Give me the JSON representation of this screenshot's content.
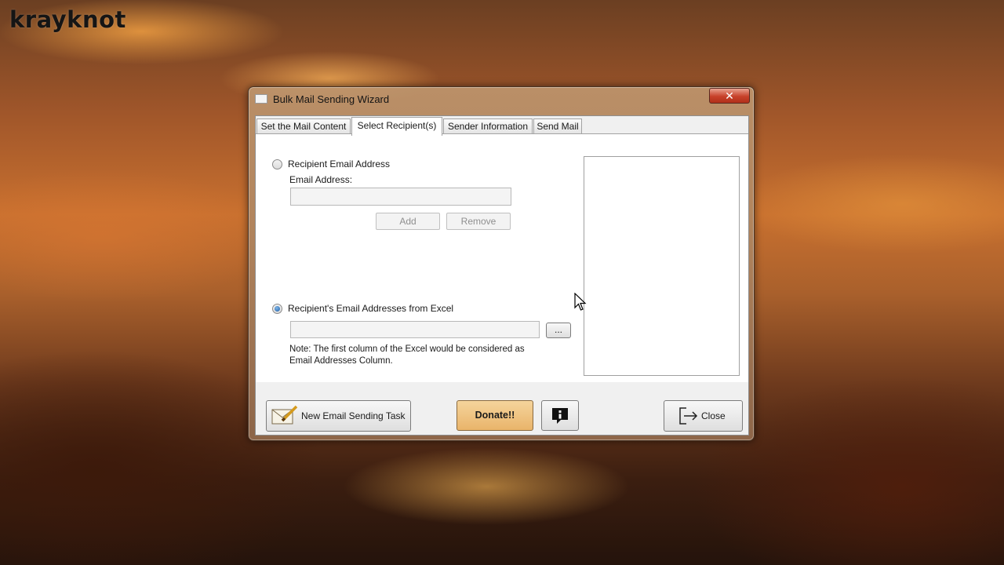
{
  "brand": "krayknot",
  "window": {
    "title": "Bulk Mail Sending Wizard",
    "close_glyph": "✕"
  },
  "tabs": [
    {
      "label": "Set the Mail Content",
      "active": false
    },
    {
      "label": "Select Recipient(s)",
      "active": true
    },
    {
      "label": "Sender Information",
      "active": false
    },
    {
      "label": "Send Mail",
      "active": false
    }
  ],
  "recipients": {
    "single_radio_label": "Recipient Email Address",
    "single_radio_checked": false,
    "email_label": "Email Address:",
    "email_value": "",
    "add_label": "Add",
    "remove_label": "Remove",
    "excel_radio_label": "Recipient's Email Addresses from Excel",
    "excel_radio_checked": true,
    "excel_path_value": "",
    "browse_label": "...",
    "note": "Note: The first column of the Excel would be considered as Email Addresses Column."
  },
  "footer": {
    "new_task_label": "New Email Sending Task",
    "donate_label": "Donate!!",
    "info_label": "i",
    "close_label": "Close"
  },
  "icons": {
    "new_task": "envelope-pencil-icon",
    "info": "info-bubble-icon",
    "close": "exit-arrow-icon",
    "cursor": "mouse-pointer-icon"
  }
}
